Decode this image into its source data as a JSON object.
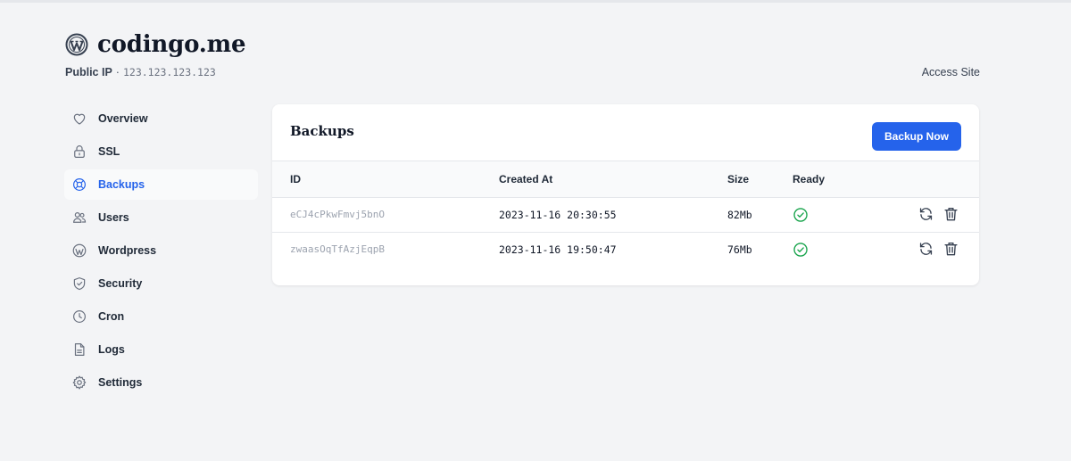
{
  "site": {
    "title": "codingo.me",
    "ip_label": "Public IP",
    "ip_separator": "·",
    "ip_value": "123.123.123.123",
    "access_site": "Access Site"
  },
  "sidebar": {
    "items": [
      {
        "label": "Overview",
        "icon": "heart-icon"
      },
      {
        "label": "SSL",
        "icon": "lock-icon"
      },
      {
        "label": "Backups",
        "icon": "lifebuoy-icon",
        "active": true
      },
      {
        "label": "Users",
        "icon": "users-icon"
      },
      {
        "label": "Wordpress",
        "icon": "wordpress-icon"
      },
      {
        "label": "Security",
        "icon": "shield-check-icon"
      },
      {
        "label": "Cron",
        "icon": "clock-icon"
      },
      {
        "label": "Logs",
        "icon": "document-icon"
      },
      {
        "label": "Settings",
        "icon": "gear-icon"
      }
    ]
  },
  "backups": {
    "title": "Backups",
    "backup_now": "Backup Now",
    "columns": {
      "id": "ID",
      "created_at": "Created At",
      "size": "Size",
      "ready": "Ready"
    },
    "rows": [
      {
        "id": "eCJ4cPkwFmvj5bnO",
        "created_at": "2023-11-16 20:30:55",
        "size": "82Mb",
        "ready": true
      },
      {
        "id": "zwaasOqTfAzjEqpB",
        "created_at": "2023-11-16 19:50:47",
        "size": "76Mb",
        "ready": true
      }
    ]
  },
  "colors": {
    "accent": "#2563eb",
    "ready_green": "#16a34a",
    "background": "#f3f4f6"
  }
}
